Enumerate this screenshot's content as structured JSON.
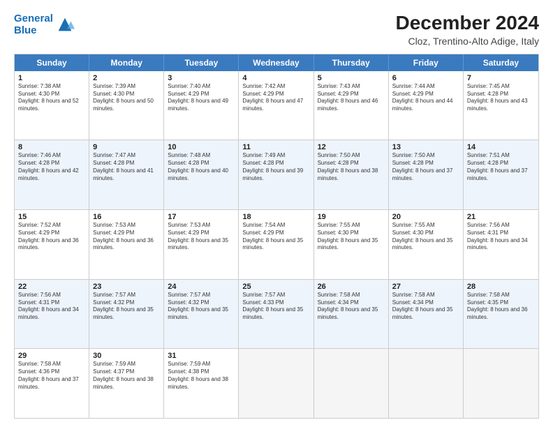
{
  "logo": {
    "line1": "General",
    "line2": "Blue"
  },
  "title": "December 2024",
  "subtitle": "Cloz, Trentino-Alto Adige, Italy",
  "days": [
    "Sunday",
    "Monday",
    "Tuesday",
    "Wednesday",
    "Thursday",
    "Friday",
    "Saturday"
  ],
  "weeks": [
    [
      {
        "day": "1",
        "sunrise": "7:38 AM",
        "sunset": "4:30 PM",
        "daylight": "8 hours and 52 minutes."
      },
      {
        "day": "2",
        "sunrise": "7:39 AM",
        "sunset": "4:30 PM",
        "daylight": "8 hours and 50 minutes."
      },
      {
        "day": "3",
        "sunrise": "7:40 AM",
        "sunset": "4:29 PM",
        "daylight": "8 hours and 49 minutes."
      },
      {
        "day": "4",
        "sunrise": "7:42 AM",
        "sunset": "4:29 PM",
        "daylight": "8 hours and 47 minutes."
      },
      {
        "day": "5",
        "sunrise": "7:43 AM",
        "sunset": "4:29 PM",
        "daylight": "8 hours and 46 minutes."
      },
      {
        "day": "6",
        "sunrise": "7:44 AM",
        "sunset": "4:29 PM",
        "daylight": "8 hours and 44 minutes."
      },
      {
        "day": "7",
        "sunrise": "7:45 AM",
        "sunset": "4:28 PM",
        "daylight": "8 hours and 43 minutes."
      }
    ],
    [
      {
        "day": "8",
        "sunrise": "7:46 AM",
        "sunset": "4:28 PM",
        "daylight": "8 hours and 42 minutes."
      },
      {
        "day": "9",
        "sunrise": "7:47 AM",
        "sunset": "4:28 PM",
        "daylight": "8 hours and 41 minutes."
      },
      {
        "day": "10",
        "sunrise": "7:48 AM",
        "sunset": "4:28 PM",
        "daylight": "8 hours and 40 minutes."
      },
      {
        "day": "11",
        "sunrise": "7:49 AM",
        "sunset": "4:28 PM",
        "daylight": "8 hours and 39 minutes."
      },
      {
        "day": "12",
        "sunrise": "7:50 AM",
        "sunset": "4:28 PM",
        "daylight": "8 hours and 38 minutes."
      },
      {
        "day": "13",
        "sunrise": "7:50 AM",
        "sunset": "4:28 PM",
        "daylight": "8 hours and 37 minutes."
      },
      {
        "day": "14",
        "sunrise": "7:51 AM",
        "sunset": "4:28 PM",
        "daylight": "8 hours and 37 minutes."
      }
    ],
    [
      {
        "day": "15",
        "sunrise": "7:52 AM",
        "sunset": "4:29 PM",
        "daylight": "8 hours and 36 minutes."
      },
      {
        "day": "16",
        "sunrise": "7:53 AM",
        "sunset": "4:29 PM",
        "daylight": "8 hours and 36 minutes."
      },
      {
        "day": "17",
        "sunrise": "7:53 AM",
        "sunset": "4:29 PM",
        "daylight": "8 hours and 35 minutes."
      },
      {
        "day": "18",
        "sunrise": "7:54 AM",
        "sunset": "4:29 PM",
        "daylight": "8 hours and 35 minutes."
      },
      {
        "day": "19",
        "sunrise": "7:55 AM",
        "sunset": "4:30 PM",
        "daylight": "8 hours and 35 minutes."
      },
      {
        "day": "20",
        "sunrise": "7:55 AM",
        "sunset": "4:30 PM",
        "daylight": "8 hours and 35 minutes."
      },
      {
        "day": "21",
        "sunrise": "7:56 AM",
        "sunset": "4:31 PM",
        "daylight": "8 hours and 34 minutes."
      }
    ],
    [
      {
        "day": "22",
        "sunrise": "7:56 AM",
        "sunset": "4:31 PM",
        "daylight": "8 hours and 34 minutes."
      },
      {
        "day": "23",
        "sunrise": "7:57 AM",
        "sunset": "4:32 PM",
        "daylight": "8 hours and 35 minutes."
      },
      {
        "day": "24",
        "sunrise": "7:57 AM",
        "sunset": "4:32 PM",
        "daylight": "8 hours and 35 minutes."
      },
      {
        "day": "25",
        "sunrise": "7:57 AM",
        "sunset": "4:33 PM",
        "daylight": "8 hours and 35 minutes."
      },
      {
        "day": "26",
        "sunrise": "7:58 AM",
        "sunset": "4:34 PM",
        "daylight": "8 hours and 35 minutes."
      },
      {
        "day": "27",
        "sunrise": "7:58 AM",
        "sunset": "4:34 PM",
        "daylight": "8 hours and 35 minutes."
      },
      {
        "day": "28",
        "sunrise": "7:58 AM",
        "sunset": "4:35 PM",
        "daylight": "8 hours and 36 minutes."
      }
    ],
    [
      {
        "day": "29",
        "sunrise": "7:58 AM",
        "sunset": "4:36 PM",
        "daylight": "8 hours and 37 minutes."
      },
      {
        "day": "30",
        "sunrise": "7:59 AM",
        "sunset": "4:37 PM",
        "daylight": "8 hours and 38 minutes."
      },
      {
        "day": "31",
        "sunrise": "7:59 AM",
        "sunset": "4:38 PM",
        "daylight": "8 hours and 38 minutes."
      },
      null,
      null,
      null,
      null
    ]
  ]
}
